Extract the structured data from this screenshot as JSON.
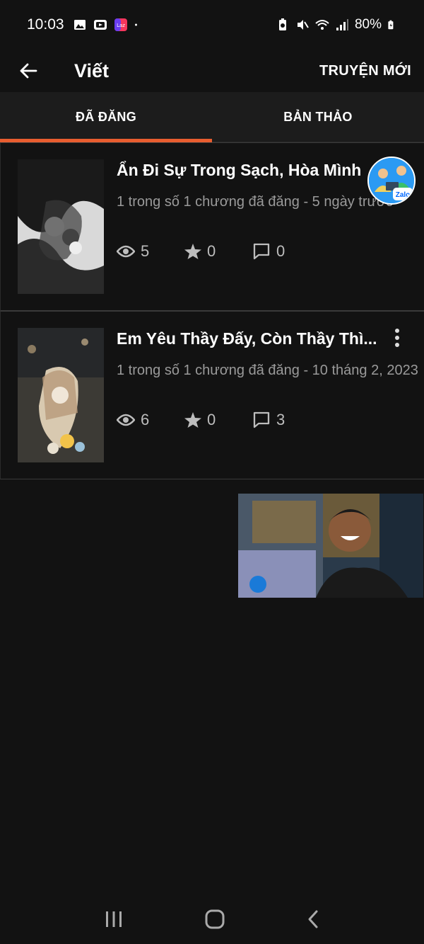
{
  "status_bar": {
    "time": "10:03",
    "battery": "80%"
  },
  "app_bar": {
    "title": "Viết",
    "new_story_label": "TRUYỆN MỚI"
  },
  "tabs": [
    {
      "label": "ĐÃ ĐĂNG",
      "active": true
    },
    {
      "label": "BẢN THẢO",
      "active": false
    }
  ],
  "stories": [
    {
      "title": "Ẩn Đi Sự Trong Sạch, Hòa Mình",
      "meta": "1 trong số 1 chương đã đăng - 5 ngày trước",
      "views": "5",
      "votes": "0",
      "comments": "0"
    },
    {
      "title": "Em Yêu Thầy Đấy, Còn Thầy Thì...",
      "meta": "1 trong số 1 chương đã đăng - 10 tháng 2, 2023",
      "views": "6",
      "votes": "0",
      "comments": "3"
    }
  ],
  "zalo_bubble": {
    "label": "Zalo"
  },
  "icons": {
    "back": "arrow-left-icon",
    "views": "eye-icon",
    "votes": "star-icon",
    "comments": "comment-icon",
    "more": "more-vertical-icon"
  },
  "colors": {
    "accent": "#e85d2f",
    "background": "#121212",
    "tab_background": "#1c1c1c"
  }
}
